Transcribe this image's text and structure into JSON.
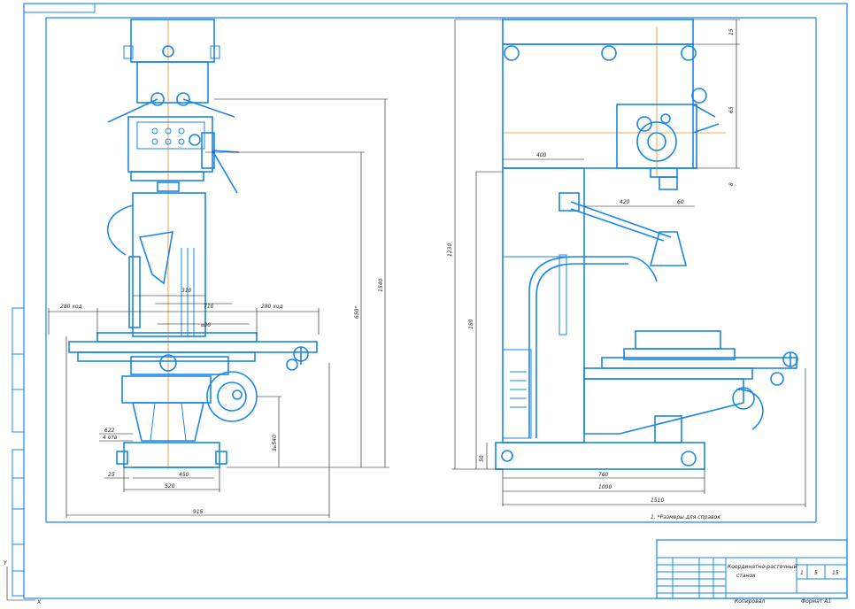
{
  "colors": {
    "outline": "#1a86e8",
    "centerline": "#f08a1a",
    "dimension": "#111111",
    "background": "#ffffff"
  },
  "front_view": {
    "dims": {
      "d280_left": "280 ход",
      "d310": "310",
      "d710": "710",
      "d630": "⌀30",
      "d280_right": "280 ход",
      "d650": "650*",
      "d1540": "1540",
      "d3460": "3ь540",
      "d622": "622",
      "d4otv": "4 отв",
      "d25": "25",
      "d450": "450",
      "d520": "520",
      "d915": "915"
    }
  },
  "side_view": {
    "dims": {
      "d15": "15",
      "d65": "65",
      "d8": "8",
      "d400": "400",
      "d420": "420",
      "d60": "60",
      "d1230": "1230",
      "d180": "180",
      "d50": "50",
      "d760": "760",
      "d1000": "1000",
      "d1510": "1510"
    },
    "note": "1. *Размеры для справок"
  },
  "title_block": {
    "title_line1": "Координатно-расточный",
    "title_line2": "станок",
    "sheet_info_1": "1",
    "sheet_info_2": "5",
    "sheet_info_3": "15",
    "copied": "Копировал",
    "format": "Формат А1"
  },
  "axis_labels": {
    "y": "Y",
    "x": "X"
  }
}
